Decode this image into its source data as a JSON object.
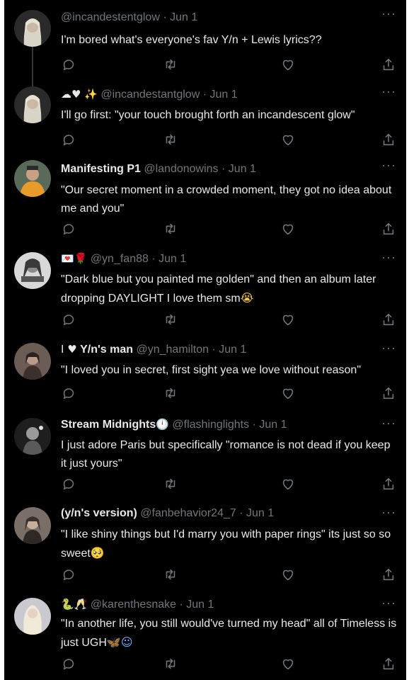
{
  "theme": {
    "background": "#000000",
    "text": "#e7e9ea",
    "muted": "#71767b",
    "line": "#333639"
  },
  "more_label": "···",
  "tweets": [
    {
      "display_name": "",
      "name_prefix": "",
      "handle": "@incandestentglow",
      "date": "Jun 1",
      "text": "I'm bored what's everyone's fav Y/n + Lewis lyrics??",
      "avatar_icon": "avatar-photo-blonde"
    },
    {
      "display_name": "",
      "name_prefix": "☁♥  ✨",
      "handle": "@incandestantglow",
      "date": "Jun 1",
      "text": "I'll go first: \"your touch brought forth an incandescent glow\"",
      "avatar_icon": "avatar-photo-blonde"
    },
    {
      "display_name": "Manifesting P1",
      "name_prefix": "",
      "handle": "@landonowins",
      "date": "Jun 1",
      "text": "\"Our secret moment in a crowded moment, they got no idea about me and you\"",
      "avatar_icon": "avatar-photo-orange"
    },
    {
      "display_name": "",
      "name_prefix": "💌🌹",
      "handle": "@yn_fan88",
      "date": "Jun 1",
      "text": "\"Dark blue but you painted me golden\" and then an album later dropping DAYLIGHT I love them sm",
      "text_suffix_emoji": "😭",
      "avatar_icon": "avatar-photo-bw"
    },
    {
      "display_name": "Y/n's man",
      "name_prefix": "I ♥",
      "handle": "@yn_hamilton",
      "date": "Jun 1",
      "text": "\"I loved you in secret, first sight yea we love without reason\"",
      "avatar_icon": "avatar-photo-dark"
    },
    {
      "display_name": "Stream Midnights",
      "name_prefix": "",
      "name_suffix_emoji": "🕛",
      "handle": "@flashinglights",
      "date": "Jun 1",
      "text": "I just adore Paris but specifically \"romance is not dead if you keep it just yours\"",
      "avatar_icon": "avatar-photo-bw"
    },
    {
      "display_name": "(y/n's version)",
      "name_prefix": "",
      "handle": "@fanbehavior24_7",
      "date": "Jun 1",
      "text": "\"I like shiny things but I'd marry you with paper rings\" its just so so sweet",
      "text_suffix_emoji": "🥺",
      "avatar_icon": "avatar-photo-dark"
    },
    {
      "display_name": "",
      "name_prefix": "🐍🥂",
      "handle": "@karenthesnake",
      "date": "Jun 1",
      "text": "\"In another life, you still would've turned my head\" all of Timeless is just UGH",
      "text_suffix_emoji": "🦋☺",
      "avatar_icon": "avatar-photo-blonde"
    }
  ]
}
